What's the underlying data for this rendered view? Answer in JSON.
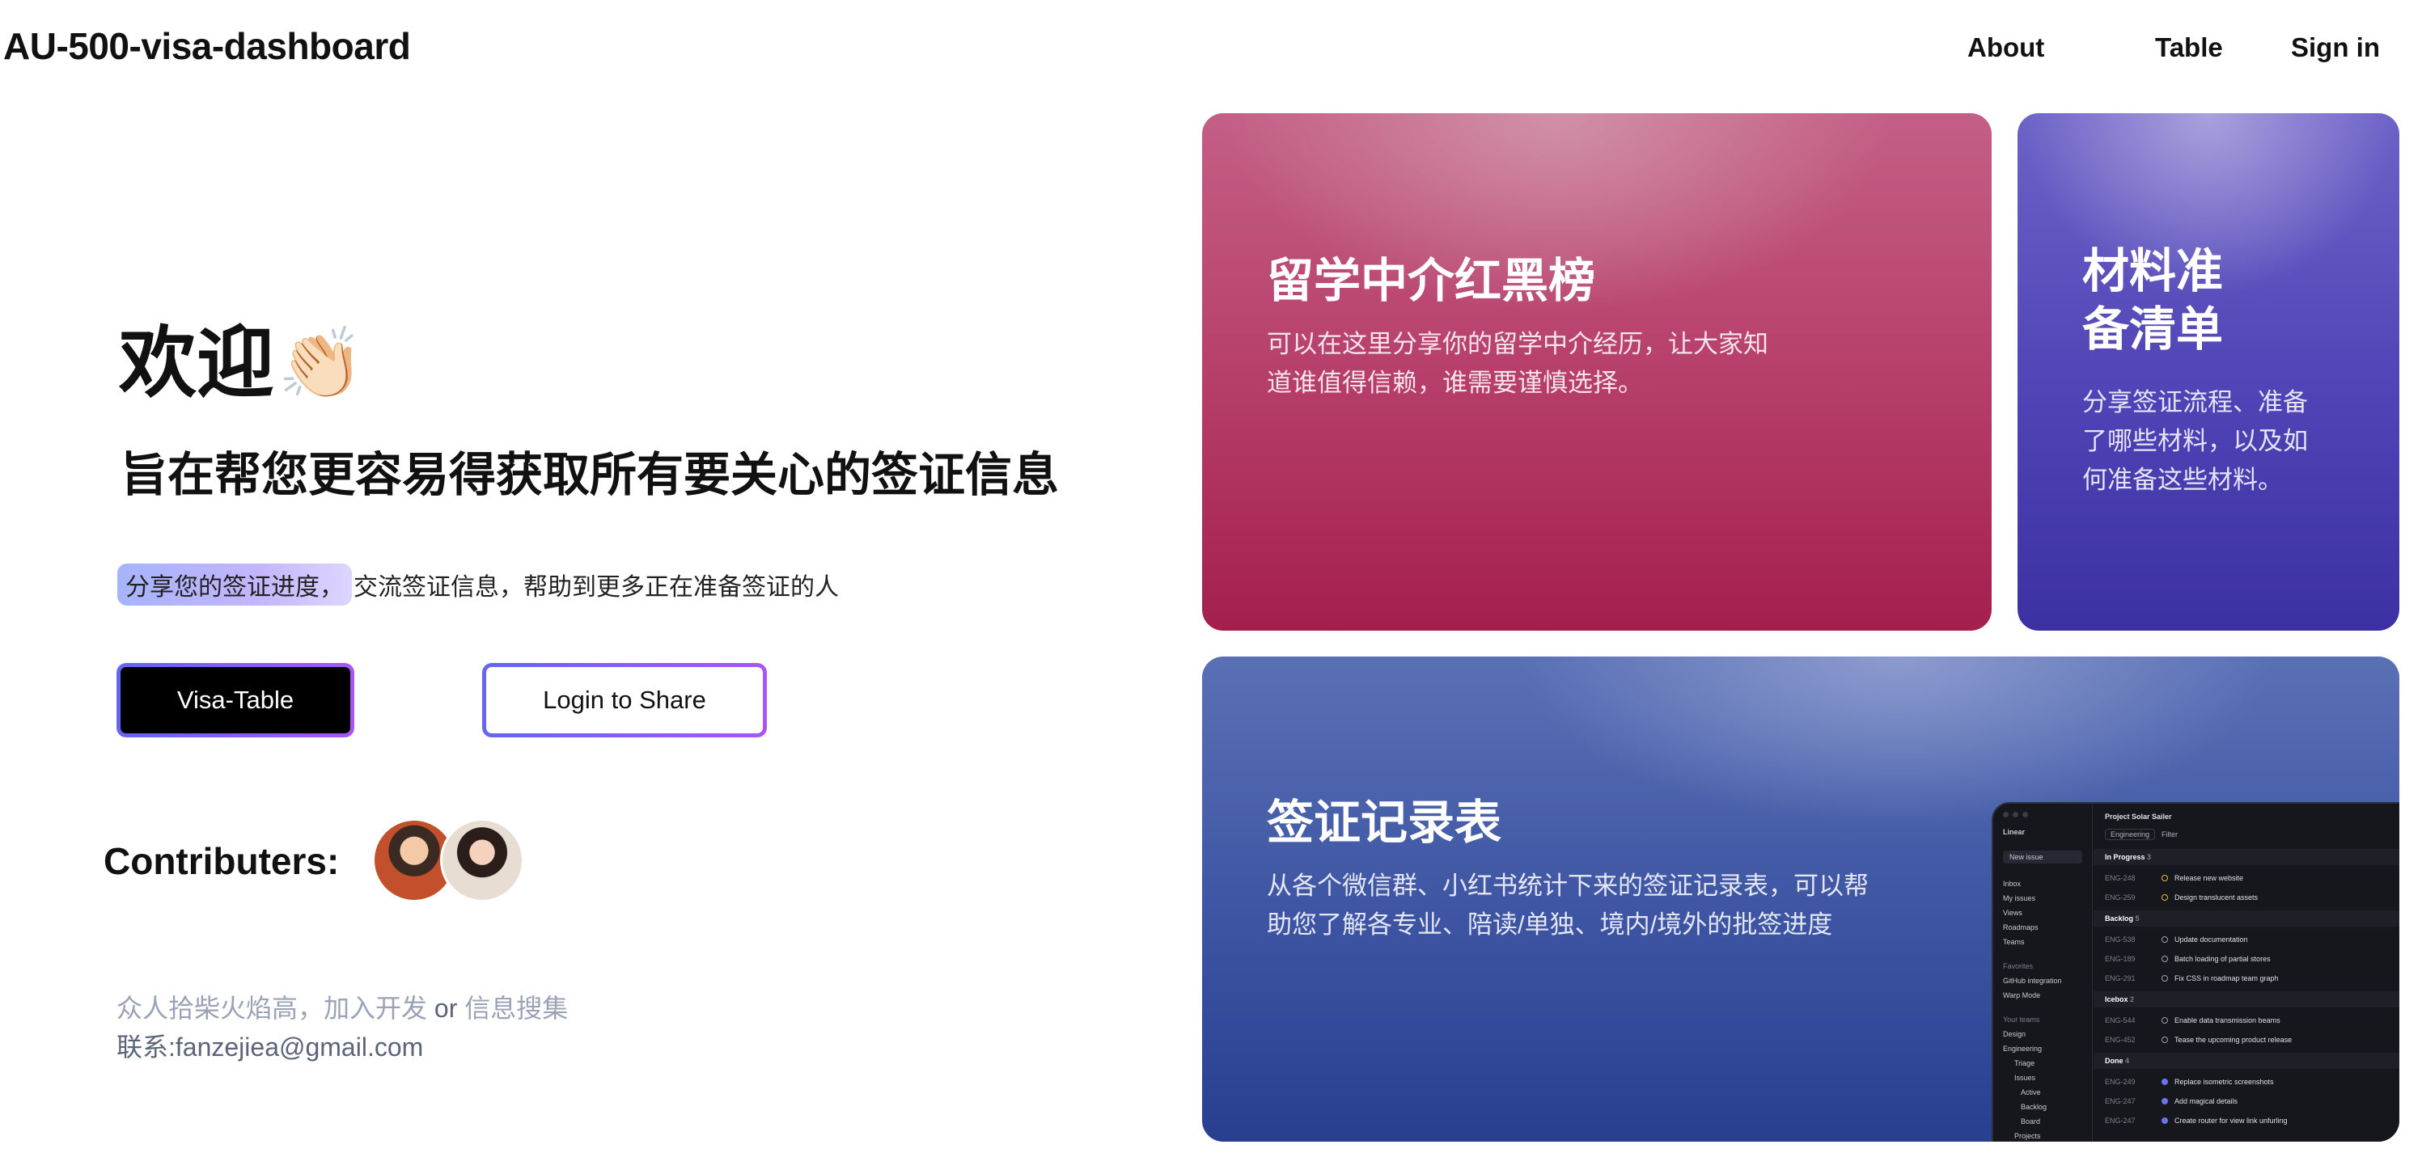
{
  "header": {
    "brand": "AU-500-visa-dashboard",
    "nav": {
      "about": "About",
      "table": "Table",
      "signin": "Sign in"
    }
  },
  "hero": {
    "welcome": "欢迎",
    "clap_emoji": "👏🏻",
    "subheading": "旨在帮您更容易得获取所有要关心的签证信息",
    "highlight": "分享您的签证进度，",
    "description_rest": "交流签证信息，帮助到更多正在准备签证的人",
    "primary_button": "Visa-Table",
    "secondary_button": "Login to Share"
  },
  "contributors": {
    "label": "Contributers:"
  },
  "footer": {
    "line1_start": "众人拾柴火焰高，加入开发",
    "line1_mid": " or ",
    "line1_end": "信息搜集",
    "line2": "联系:fanzejiea@gmail.com"
  },
  "cards": {
    "agency": {
      "title": "留学中介红黑榜",
      "text_line1": "可以在这里分享你的留学中介经历，让大家知",
      "text_line2": "道谁值得信赖，谁需要谨慎选择。"
    },
    "materials": {
      "title_line1": "材料准",
      "title_line2": "备清单",
      "text_line1": "分享签证流程、准备",
      "text_line2": "了哪些材料，以及如",
      "text_line3": "何准备这些材料。"
    },
    "records": {
      "title": "签证记录表",
      "text_line1": "从各个微信群、小红书统计下来的签证记录表，可以帮",
      "text_line2": "助您了解各专业、陪读/单独、境内/境外的批签进度"
    }
  },
  "mini_app": {
    "workspace": "Linear",
    "new_issue": "New issue",
    "sidebar": [
      "Inbox",
      "My issues",
      "Views",
      "Roadmaps",
      "Teams"
    ],
    "favorites_label": "Favorites",
    "favorites": [
      "GitHub integration",
      "Warp Mode"
    ],
    "teams_label": "Your teams",
    "teams": [
      "Design",
      "Engineering",
      "Triage",
      "Issues",
      "Active",
      "Backlog",
      "Board",
      "Projects"
    ],
    "project": "Project Solar Sailer",
    "filter_team": "Engineering",
    "filter_label": "Filter",
    "groups": {
      "in_progress": "In Progress",
      "in_progress_count": "3",
      "backlog": "Backlog",
      "backlog_count": "5",
      "icebox": "Icebox",
      "icebox_count": "2",
      "done": "Done",
      "done_count": "4"
    },
    "issues": [
      {
        "id": "ENG-248",
        "title": "Release new website"
      },
      {
        "id": "ENG-259",
        "title": "Design translucent assets"
      },
      {
        "id": "ENG-538",
        "title": "Update documentation"
      },
      {
        "id": "ENG-189",
        "title": "Batch loading of partial stores"
      },
      {
        "id": "ENG-291",
        "title": "Fix CSS in roadmap team graph"
      },
      {
        "id": "ENG-544",
        "title": "Enable data transmission beams"
      },
      {
        "id": "ENG-452",
        "title": "Tease the upcoming product release"
      },
      {
        "id": "ENG-249",
        "title": "Replace isometric screenshots"
      },
      {
        "id": "ENG-247",
        "title": "Add magical details"
      },
      {
        "id": "ENG-247",
        "title": "Create router for view link unfurling"
      }
    ]
  }
}
